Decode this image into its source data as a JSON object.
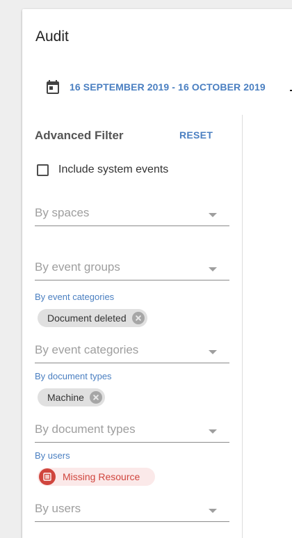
{
  "page": {
    "title": "Audit"
  },
  "date_range": {
    "icon": "calendar-icon",
    "text": "16 SEPTEMBER 2019 - 16 OCTOBER 2019"
  },
  "filter": {
    "title": "Advanced Filter",
    "reset_label": "RESET",
    "include_system_events": {
      "label": "Include system events",
      "checked": false
    },
    "by_spaces": {
      "placeholder": "By spaces"
    },
    "by_event_groups": {
      "placeholder": "By event groups"
    },
    "by_event_categories": {
      "label": "By event categories",
      "chips": [
        "Document deleted"
      ],
      "placeholder": "By event categories"
    },
    "by_document_types": {
      "label": "By document types",
      "chips": [
        "Machine"
      ],
      "placeholder": "By document types"
    },
    "by_users": {
      "label": "By users",
      "chips": [
        "Missing Resource"
      ],
      "placeholder": "By users"
    }
  },
  "colors": {
    "accent": "#4a7fc1",
    "error": "#d0453d",
    "error_bg": "#fbe9e9",
    "chip_bg": "#e0e0e0"
  }
}
